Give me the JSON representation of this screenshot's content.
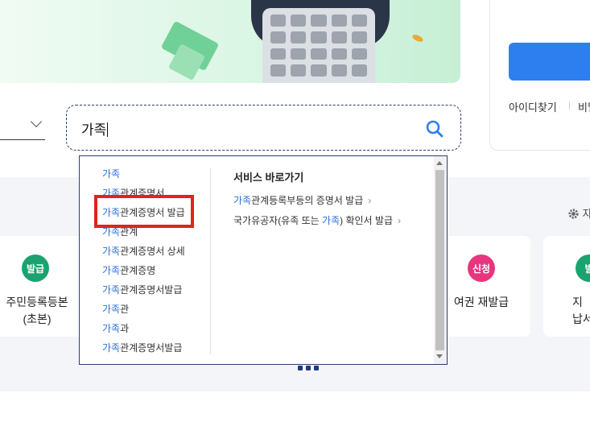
{
  "search": {
    "query": "가족",
    "suggestions": [
      {
        "hl": "가족",
        "rest": ""
      },
      {
        "hl": "가족",
        "rest": "관계증명서"
      },
      {
        "hl": "가족",
        "rest": "관계증명서 발급"
      },
      {
        "hl": "가족",
        "rest": "관계"
      },
      {
        "hl": "가족",
        "rest": "관계증명서 상세"
      },
      {
        "hl": "가족",
        "rest": "관계증명"
      },
      {
        "hl": "가족",
        "rest": "관계증명서발급"
      },
      {
        "hl": "가족",
        "rest": "관"
      },
      {
        "hl": "가족",
        "rest": "과"
      },
      {
        "hl": "가족",
        "rest": "관계증명서발급"
      }
    ],
    "shortcuts_title": "서비스 바로가기",
    "shortcuts": [
      {
        "pre": "",
        "hl": "가족",
        "post": "관계등록부등의 증명서 발급",
        "arrow": "›"
      },
      {
        "pre": "국가유공자(유족 또는 ",
        "hl": "가족",
        "post": ") 확인서 발급",
        "arrow": "›"
      }
    ]
  },
  "login": {
    "find_id": "아이디찾기",
    "find_pw": "비밀"
  },
  "settings_label": "자",
  "services": [
    {
      "badge": "발급",
      "badge_color": "#1aa36f",
      "label_line1": "주민등록등본",
      "label_line2": "(초본)"
    },
    {
      "badge": "신청",
      "badge_color": "#e8357e",
      "label_line1": "여권 재발급",
      "label_line2": ""
    },
    {
      "badge": "발",
      "badge_color": "#1aa36f",
      "label_line1": "지",
      "label_line2": "납서"
    }
  ],
  "colors": {
    "accent": "#2d7ff0",
    "highlight_text": "#2b6fd6",
    "annotation": "#e2231a"
  }
}
